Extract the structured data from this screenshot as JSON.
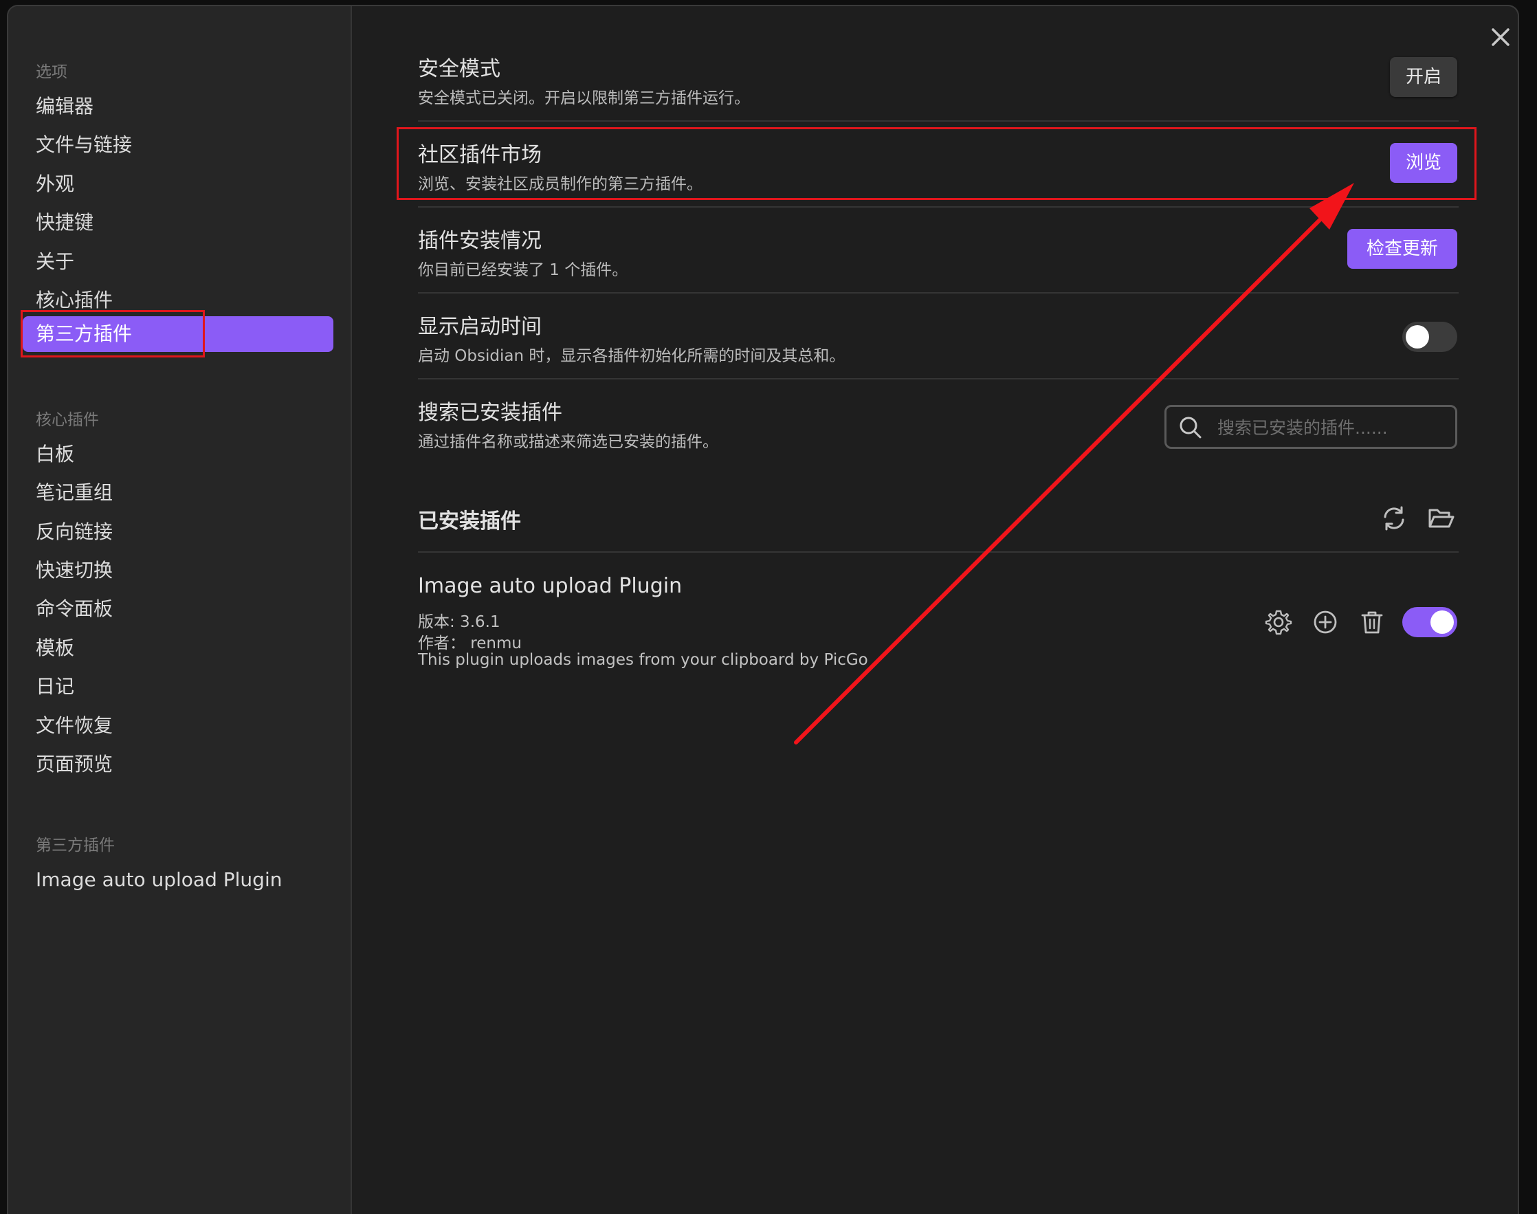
{
  "sidebar": {
    "options_title": "选项",
    "options": [
      "编辑器",
      "文件与链接",
      "外观",
      "快捷键",
      "关于",
      "核心插件",
      "第三方插件"
    ],
    "core_title": "核心插件",
    "core_plugins": [
      "白板",
      "笔记重组",
      "反向链接",
      "快速切换",
      "命令面板",
      "模板",
      "日记",
      "文件恢复",
      "页面预览"
    ],
    "third_title": "第三方插件",
    "third_plugins": [
      "Image auto upload Plugin"
    ]
  },
  "settings": {
    "safe_mode": {
      "title": "安全模式",
      "desc": "安全模式已关闭。开启以限制第三方插件运行。",
      "button": "开启"
    },
    "community": {
      "title": "社区插件市场",
      "desc": "浏览、安装社区成员制作的第三方插件。",
      "button": "浏览"
    },
    "install_status": {
      "title": "插件安装情况",
      "desc": "你目前已经安装了 1 个插件。",
      "button": "检查更新"
    },
    "startup_time": {
      "title": "显示启动时间",
      "desc": "启动 Obsidian 时，显示各插件初始化所需的时间及其总和。",
      "enabled": false
    },
    "search": {
      "title": "搜索已安装插件",
      "desc": "通过插件名称或描述来筛选已安装的插件。",
      "placeholder": "搜索已安装的插件......"
    }
  },
  "installed": {
    "title": "已安装插件",
    "plugins": [
      {
        "name": "Image auto upload Plugin",
        "version": "版本: 3.6.1",
        "author": "作者：  renmu",
        "description": "This plugin uploads images from your clipboard by PicGo",
        "enabled": true
      }
    ]
  },
  "colors": {
    "accent": "#8b5cf6",
    "annotation_red": "#e0161c",
    "background": "#1e1e1e",
    "sidebar_bg": "#262626"
  },
  "icons": [
    "close-icon",
    "search-icon",
    "refresh-icon",
    "folder-open-icon",
    "gear-icon",
    "plus-circle-icon",
    "trash-icon",
    "annotation-arrow"
  ]
}
